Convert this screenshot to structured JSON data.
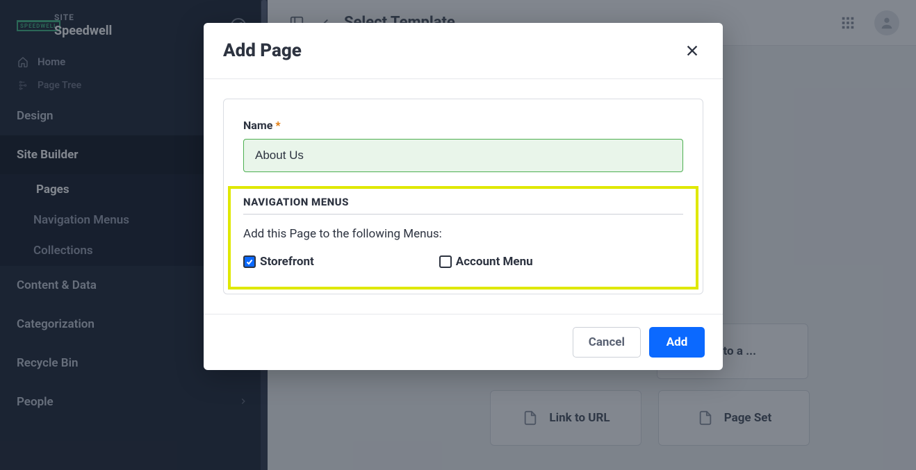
{
  "site": {
    "label": "SITE",
    "name": "Speedwell",
    "logo_text": "SPEEDWELL"
  },
  "sidebar": {
    "home": "Home",
    "page_tree": "Page Tree",
    "design": "Design",
    "site_builder": "Site Builder",
    "pages": "Pages",
    "navigation_menus": "Navigation Menus",
    "collections": "Collections",
    "content_data": "Content & Data",
    "categorization": "Categorization",
    "recycle_bin": "Recycle Bin",
    "people": "People"
  },
  "header": {
    "title": "Select Template"
  },
  "templates": {
    "link_to_a": "Link to a ...",
    "link_to_url": "Link to URL",
    "page_set": "Page Set"
  },
  "modal": {
    "title": "Add Page",
    "name_label": "Name",
    "name_value": "About Us",
    "nav_menus_heading": "NAVIGATION MENUS",
    "nav_menus_help": "Add this Page to the following Menus:",
    "menu_storefront": "Storefront",
    "menu_account": "Account Menu",
    "cancel": "Cancel",
    "add": "Add"
  }
}
